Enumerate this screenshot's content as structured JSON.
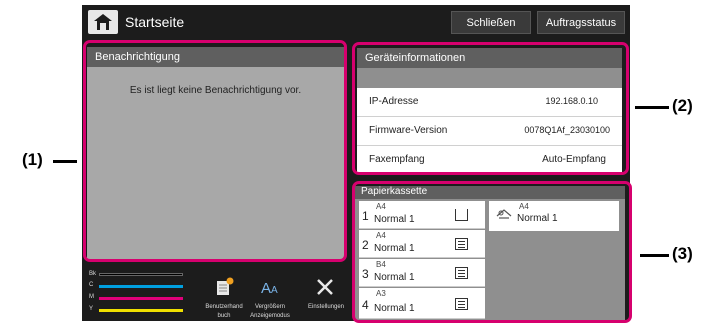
{
  "topbar": {
    "title": "Startseite",
    "close_label": "Schließen",
    "jobstatus_label": "Auftragsstatus"
  },
  "notification": {
    "header": "Benachrichtigung",
    "message": "Es ist liegt keine Benachrichtigung vor."
  },
  "device_info": {
    "header": "Geräteinformationen",
    "rows": [
      {
        "label": "IP-Adresse",
        "value": "192.168.0.10"
      },
      {
        "label": "Firmware-Version",
        "value": "0078Q1Af_23030100"
      },
      {
        "label": "Faxempfang",
        "value": "Auto-Empfang"
      }
    ]
  },
  "paper": {
    "header": "Papierkassette",
    "trays": [
      {
        "num": "1",
        "size": "A4",
        "type": "Normal 1"
      },
      {
        "num": "2",
        "size": "A4",
        "type": "Normal 1"
      },
      {
        "num": "3",
        "size": "B4",
        "type": "Normal 1"
      },
      {
        "num": "4",
        "size": "A3",
        "type": "Normal 1"
      }
    ],
    "bypass": {
      "size": "A4",
      "type": "Normal 1"
    }
  },
  "toner": {
    "labels": [
      "Bk",
      "C",
      "M",
      "Y"
    ],
    "colors": [
      "#000000",
      "#00a0e0",
      "#e0007a",
      "#f0e000"
    ]
  },
  "bottom_items": {
    "manual": "Benutzerhand buch",
    "zoom_line1": "Vergrößern",
    "zoom_line2": "Anzeigemodus",
    "settings": "Einstellungen"
  },
  "callouts": {
    "c1": "(1)",
    "c2": "(2)",
    "c3": "(3)"
  },
  "colors": {
    "highlight": "#d6006e",
    "panel_header": "#5f5f5f",
    "screen_bg": "#1c1c1c"
  }
}
